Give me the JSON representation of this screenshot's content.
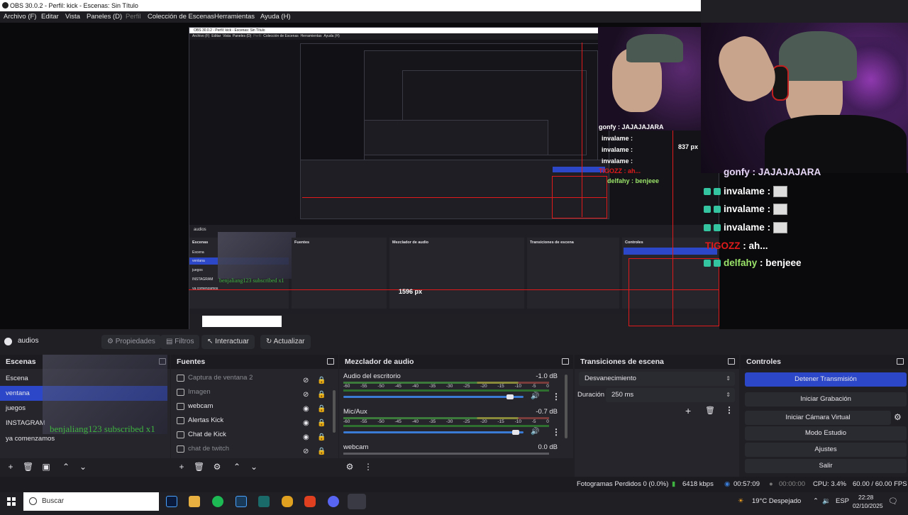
{
  "window": {
    "title": "OBS 30.0.2 - Perfil: kick - Escenas: Sin Título"
  },
  "menu": [
    "Archivo (F)",
    "Editar",
    "Vista",
    "Paneles (D)",
    "Perfil",
    "Colección de Escenas",
    "Herramientas",
    "Ayuda (H)"
  ],
  "preview": {
    "nested_title": "OBS 30.0.2 - Perfil: kick - Escenas: Sin Título",
    "nested_menu": [
      "Archivo (F)",
      "Editar",
      "Vista",
      "Paneles (D)",
      "Perfil",
      "Colección de Escenas",
      "Herramientas",
      "Ayuda (H)"
    ],
    "px_label_height": "837 px",
    "px_label_width": "1596 px",
    "sub_overlay": "benjaliang123 subscribed x1",
    "chat": [
      {
        "user": "invalame",
        "text": ":"
      },
      {
        "user": "invalame",
        "text": ":"
      },
      {
        "user": "invalame",
        "text": ":"
      },
      {
        "user": "TIGOZZ",
        "text": ": ah..."
      },
      {
        "user": "delfahy",
        "text": ": benjeee"
      }
    ],
    "chat_top": "gonfy : JAJAJAJARA",
    "mini_chat": [
      "invalame :",
      "invalame :",
      "invalame :",
      "TIGOZZ : ah...",
      "delfahy : benjeee"
    ],
    "mini_chat_top": "gonfy : JAJAJAJARA"
  },
  "toolbar": {
    "scene_name": "audios",
    "properties": "Propiedades",
    "filters": "Filtros",
    "interact": "Interactuar",
    "refresh": "Actualizar"
  },
  "scenes": {
    "title": "Escenas",
    "items": [
      "Escena",
      "ventana",
      "juegos",
      "INSTAGRAM",
      "ya comenzamos"
    ],
    "active": "ventana"
  },
  "sources": {
    "title": "Fuentes",
    "items": [
      {
        "name": "Captura de ventana 2",
        "visible": false
      },
      {
        "name": "Imagen",
        "visible": false
      },
      {
        "name": "webcam",
        "visible": true
      },
      {
        "name": "Alertas Kick",
        "visible": true
      },
      {
        "name": "Chat de Kick",
        "visible": true
      },
      {
        "name": "chat de twitch",
        "visible": false
      }
    ]
  },
  "mixer": {
    "title": "Mezclador de audio",
    "ticks": [
      "-60",
      "-55",
      "-50",
      "-45",
      "-40",
      "-35",
      "-30",
      "-25",
      "-20",
      "-15",
      "-10",
      "-5",
      "0"
    ],
    "channels": [
      {
        "name": "Audio del escritorio",
        "db": "-1.0 dB",
        "level": 0.92
      },
      {
        "name": "Mic/Aux",
        "db": "-0.7 dB",
        "level": 0.95
      },
      {
        "name": "webcam",
        "db": "0.0 dB",
        "level": 1.0
      }
    ]
  },
  "transitions": {
    "title": "Transiciones de escena",
    "selected": "Desvanecimiento",
    "duration_label": "Duración",
    "duration_value": "250 ms"
  },
  "controls": {
    "title": "Controles",
    "stop_stream": "Detener Transmisión",
    "start_recording": "Iniciar Grabación",
    "virtual_camera": "Iniciar Cámara Virtual",
    "studio_mode": "Modo Estudio",
    "settings": "Ajustes",
    "exit": "Salir"
  },
  "status": {
    "dropped_frames": "Fotogramas Perdidos 0 (0.0%)",
    "bitrate": "6418 kbps",
    "stream_time": "00:57:09",
    "rec_time": "00:00:00",
    "cpu": "CPU: 3.4%",
    "fps": "60.00 / 60.00 FPS"
  },
  "taskbar": {
    "search": "Buscar",
    "weather": "19°C Despejado",
    "lang": "ESP",
    "time": "22:28",
    "date": "02/10/2025"
  }
}
